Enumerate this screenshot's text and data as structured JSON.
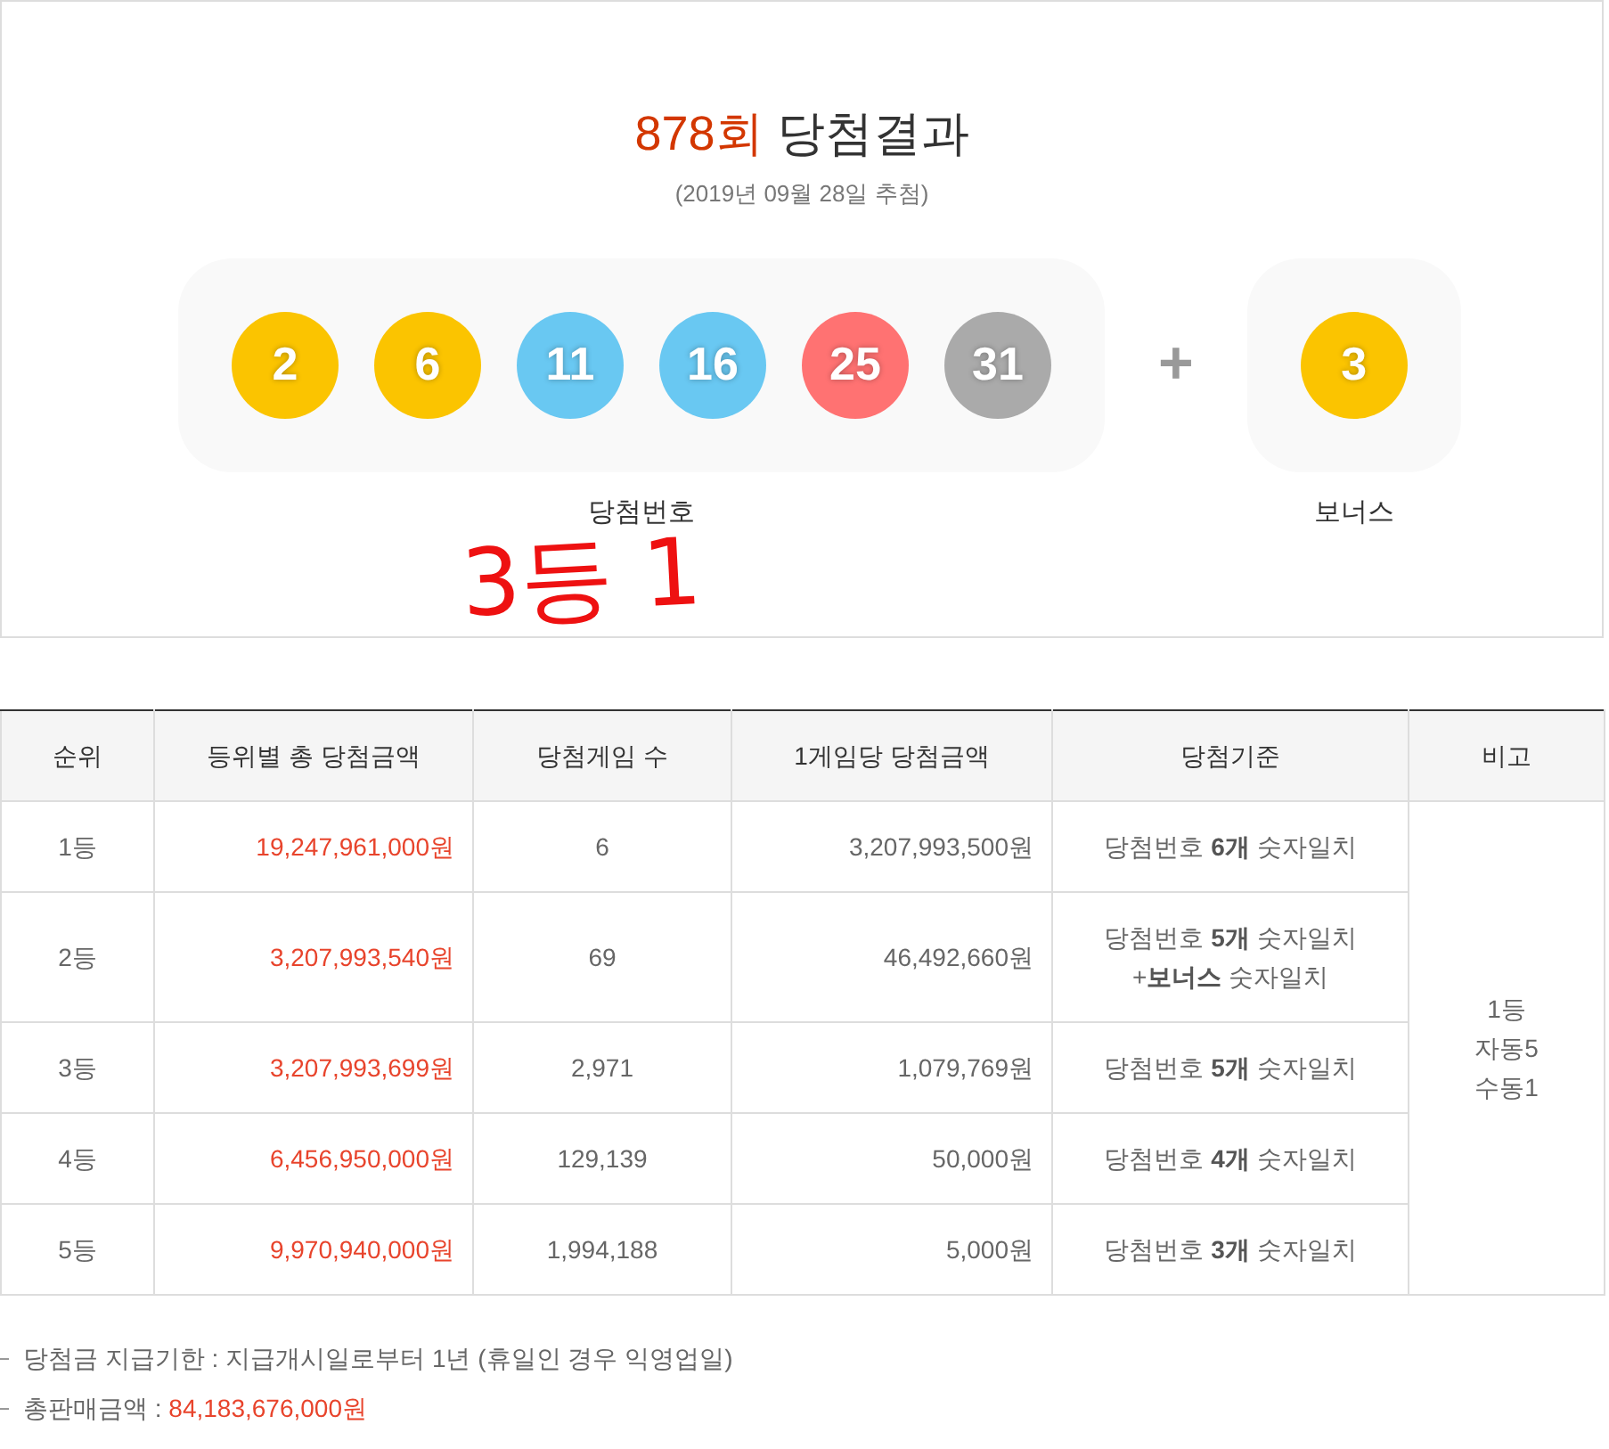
{
  "header": {
    "round": "878회",
    "title": "당첨결과",
    "date": "(2019년 09월 28일 추첨)"
  },
  "winning_numbers": {
    "label": "당첨번호",
    "balls": [
      {
        "number": "2",
        "color": "#fbc400"
      },
      {
        "number": "6",
        "color": "#fbc400"
      },
      {
        "number": "11",
        "color": "#69c8f2"
      },
      {
        "number": "16",
        "color": "#69c8f2"
      },
      {
        "number": "25",
        "color": "#ff7272"
      },
      {
        "number": "31",
        "color": "#aaaaaa"
      }
    ]
  },
  "plus": "+",
  "bonus": {
    "label": "보너스",
    "ball": {
      "number": "3",
      "color": "#fbc400"
    }
  },
  "annotation": "3등 1",
  "table": {
    "columns": [
      "순위",
      "등위별 총 당첨금액",
      "당첨게임 수",
      "1게임당 당첨금액",
      "당첨기준",
      "비고"
    ],
    "rows": [
      {
        "rank": "1등",
        "total": "19,247,961,000원",
        "games": "6",
        "per_game": "3,207,993,500원",
        "criteria": [
          "당첨번호 **6개** 숫자일치"
        ]
      },
      {
        "rank": "2등",
        "total": "3,207,993,540원",
        "games": "69",
        "per_game": "46,492,660원",
        "criteria": [
          "당첨번호 **5개** 숫자일치",
          "+**보너스** 숫자일치"
        ]
      },
      {
        "rank": "3등",
        "total": "3,207,993,699원",
        "games": "2,971",
        "per_game": "1,079,769원",
        "criteria": [
          "당첨번호 **5개** 숫자일치"
        ]
      },
      {
        "rank": "4등",
        "total": "6,456,950,000원",
        "games": "129,139",
        "per_game": "50,000원",
        "criteria": [
          "당첨번호 **4개** 숫자일치"
        ]
      },
      {
        "rank": "5등",
        "total": "9,970,940,000원",
        "games": "1,994,188",
        "per_game": "5,000원",
        "criteria": [
          "당첨번호 **3개** 숫자일치"
        ]
      }
    ],
    "remarks": [
      "1등",
      "자동5",
      "수동1"
    ]
  },
  "notes": [
    {
      "label": "당첨금 지급기한 : 지급개시일로부터 1년 (휴일인 경우 익영업일)"
    },
    {
      "label": "총판매금액 : ",
      "value": "84,183,676,000원"
    }
  ]
}
